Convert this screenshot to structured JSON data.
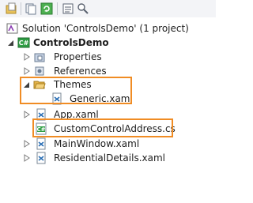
{
  "toolbar": {
    "buttons": [
      {
        "name": "new-solution-folder-button",
        "icon": "folder-page-icon"
      },
      {
        "name": "show-all-files-button",
        "icon": "files-icon"
      },
      {
        "name": "refresh-button",
        "icon": "refresh-icon"
      },
      {
        "name": "properties-button",
        "icon": "properties-icon"
      },
      {
        "name": "view-class-diagram-button",
        "icon": "class-diagram-icon"
      }
    ]
  },
  "tree": {
    "solution": "Solution 'ControlsDemo' (1 project)",
    "project": "ControlsDemo",
    "properties": "Properties",
    "references": "References",
    "themes": "Themes",
    "generic": "Generic.xaml",
    "app": "App.xaml",
    "custom_control": "CustomControlAddress.cs",
    "main_window": "MainWindow.xaml",
    "residential": "ResidentialDetails.xaml"
  },
  "colors": {
    "highlight": "#f08c24",
    "csharp_badge": "#2f9e44",
    "folder": "#e6b54a"
  }
}
